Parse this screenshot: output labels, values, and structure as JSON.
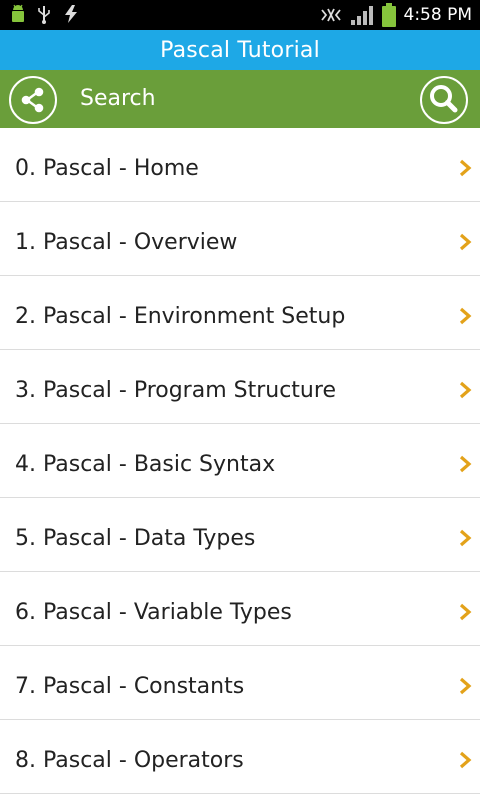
{
  "colors": {
    "title_bg": "#1ea8e6",
    "search_bg": "#6a9e3a",
    "chevron": "#e3a21a",
    "battery": "#86c43c"
  },
  "status": {
    "time": "4:58 PM"
  },
  "header": {
    "title": "Pascal Tutorial"
  },
  "search": {
    "label": "Search"
  },
  "list": {
    "items": [
      {
        "label": "0. Pascal - Home"
      },
      {
        "label": "1. Pascal - Overview"
      },
      {
        "label": "2. Pascal - Environment Setup"
      },
      {
        "label": "3. Pascal - Program Structure"
      },
      {
        "label": "4. Pascal - Basic Syntax"
      },
      {
        "label": "5. Pascal - Data Types"
      },
      {
        "label": "6. Pascal - Variable Types"
      },
      {
        "label": "7. Pascal - Constants"
      },
      {
        "label": "8. Pascal - Operators"
      }
    ]
  }
}
